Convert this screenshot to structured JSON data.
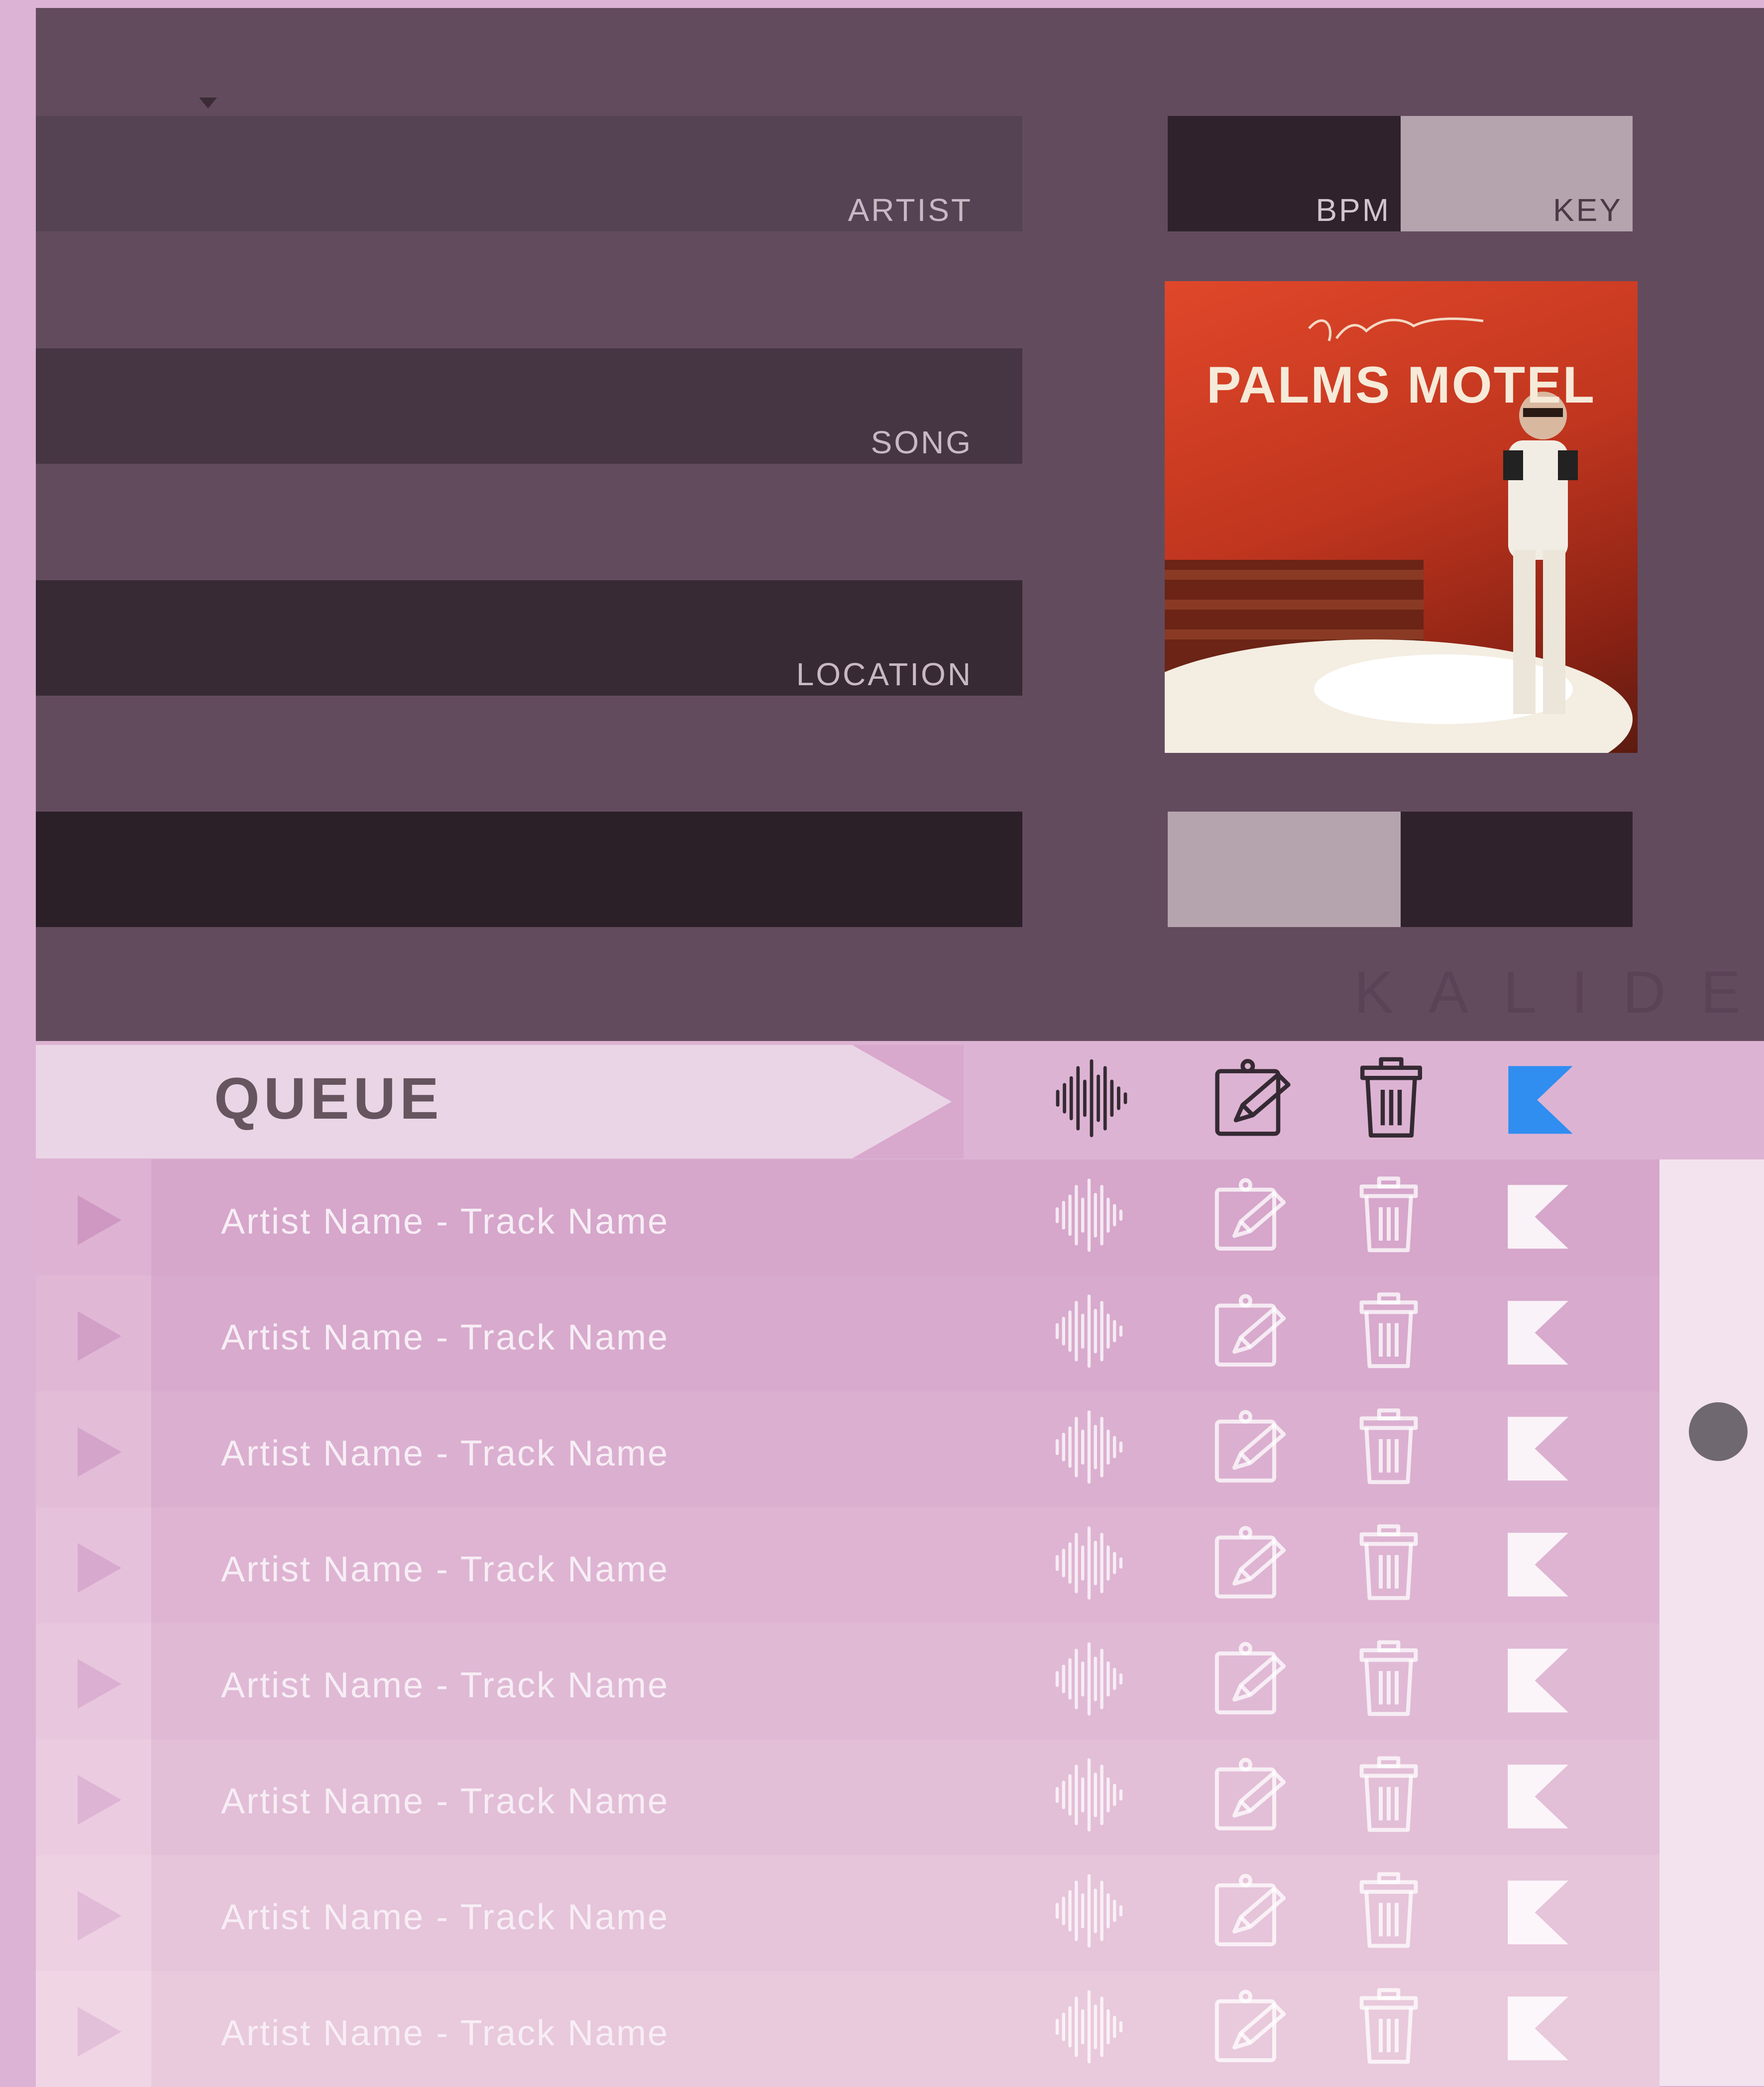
{
  "fields": {
    "artist_label": "ARTIST",
    "song_label": "SONG",
    "location_label": "LOCATION",
    "bpm_label": "BPM",
    "key_label": "KEY"
  },
  "album": {
    "title": "PALMS MOTEL",
    "signature": "Kent Odessa"
  },
  "brand": "KALIDE",
  "queue": {
    "label": "QUEUE",
    "toolbar_icons": [
      "waveform-icon",
      "edit-icon",
      "trash-icon",
      "kalide-logo-icon"
    ],
    "tracks": [
      "Artist Name - Track Name",
      "Artist Name - Track Name",
      "Artist Name - Track Name",
      "Artist Name - Track Name",
      "Artist Name - Track Name",
      "Artist Name - Track Name",
      "Artist Name - Track Name",
      "Artist Name - Track Name"
    ]
  },
  "colors": {
    "accent": "#2f8ef0",
    "panel": "#634b5e",
    "background": "#dcb3d4"
  }
}
